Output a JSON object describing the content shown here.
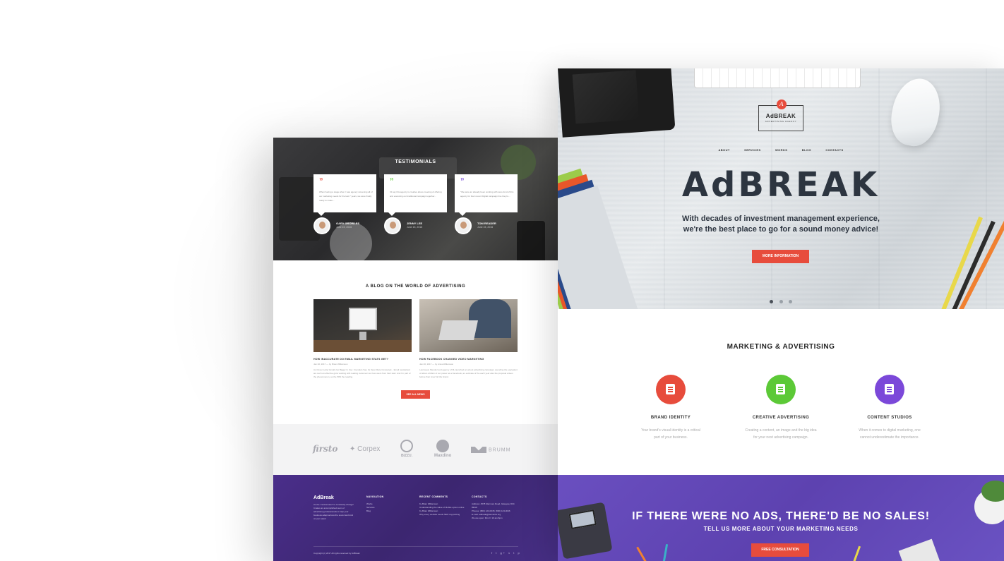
{
  "left_page": {
    "testimonials": {
      "title": "TESTIMONIALS",
      "items": [
        {
          "quote_mark": "”",
          "quote_color": "#e74c3c",
          "text": "When having a stage when I was agency screening all of our marketing needs for the last 7 years, we were finally ready to make...",
          "name": "GARY GROWLES",
          "date": "June 15, 2016"
        },
        {
          "quote_mark": "”",
          "quote_color": "#5fcf3a",
          "text": "I'd say this agency is creative above meeting of offering and executing our traditional campaign together...",
          "name": "JENNY LEE",
          "date": "June 15, 2016"
        },
        {
          "quote_mark": "”",
          "quote_color": "#7a4fd8",
          "text": "\"We were an already been working with were fond of this agency for their recent Digital campaign line they're...",
          "name": "TOM READER",
          "date": "June 15, 2016"
        }
      ]
    },
    "blog": {
      "title": "A BLOG ON THE WORLD OF ADVERTISING",
      "posts": [
        {
          "title": "HOW INACCURATE DO EMAIL MARKETING STATS GET?",
          "meta": "Jan 20, 2017 — by Brian Williamson",
          "excerpt": "As Clover Letter Emails Go Bigger In Use: Founders Say. Its Open Rate Compared... Email newsletters are such an effective grow working with reading customers so how users from their start. And I'm part of the phenomenon, as the 50% the reading."
        },
        {
          "title": "HOW FACEBOOK CHANGED VIDEO MARKETING",
          "meta": "Jan 20, 2017 — by Anna Williamson",
          "excerpt": "Last week, Mendez and agency of NL launched an all-out advertising campaign, spending the equivalent of about a billion of our power as a Facebook, an estimate of the each year also the proposal videos before their crew hid the brand."
        }
      ],
      "see_all": "SEE ALL NEWS"
    },
    "partners": [
      "firsto",
      "Corpex",
      "BIZZU.",
      "Maxdino",
      "BRUMM"
    ],
    "footer": {
      "brand": "AdBreak",
      "description": "As the \"central steel\" to constantly change! It takes an accomplished team of advertising professionals to help your business adapt across the sound and kind of your sales!",
      "columns": [
        {
          "heading": "NAVIGATION",
          "items": [
            "Works",
            "Services",
            "Blog"
          ]
        },
        {
          "heading": "RECENT COMMENTS",
          "items": [
            "by Brian Williamson",
            "Understanding the value of Mobile option online",
            "by Brian Williamson",
            "Why every website needs SEO copywriting"
          ]
        },
        {
          "heading": "CONTACTS",
          "items": [
            "Address: 4578 Marmora Road, Glasgow, D04 89GR",
            "Phones: (800) 123-0045; (800) 123-0046",
            "E-mail: adbreak@demolink.org",
            "We are open: Mn-Fr: 10 am-8pm"
          ]
        }
      ],
      "copyright": "Copyright (c) 2017 All rights reserved by AdBreak",
      "social": "f  t  g+  v  t  p"
    }
  },
  "right_page": {
    "logo": {
      "mark": "A",
      "name": "AdBREAK",
      "tagline": "ADVERTISING AGENCY"
    },
    "nav": [
      "ABOUT",
      "SERVICES",
      "WORKS",
      "BLOG",
      "CONTACTS"
    ],
    "hero": {
      "title": "AdBREAK",
      "subtitle_line1": "With decades of investment management experience,",
      "subtitle_line2": "we're the best place to go for a sound money advice!",
      "button": "MORE INFORMATION",
      "slides": 3,
      "active_slide": 1
    },
    "services": {
      "title": "MARKETING & ADVERTISING",
      "items": [
        {
          "name": "BRAND IDENTITY",
          "icon": "clipboard-icon",
          "color": "#e74c3c",
          "desc_line1": "Your brand's visual identity is a critical",
          "desc_line2": "part of your business."
        },
        {
          "name": "CREATIVE ADVERTISING",
          "icon": "chart-icon",
          "color": "#5cc937",
          "desc_line1": "Creating a content, an image and the big idea",
          "desc_line2": "for your next advertising campaign."
        },
        {
          "name": "CONTENT STUDIOS",
          "icon": "wallet-icon",
          "color": "#7b48d9",
          "desc_line1": "When it comes to digital marketing, one",
          "desc_line2": "cannot underestimate the importance."
        }
      ]
    },
    "cta": {
      "title": "IF THERE WERE NO ADS, THERE'D BE NO SALES!",
      "subtitle": "TELL US MORE ABOUT YOUR MARKETING NEEDS",
      "button": "FREE CONSULTATION"
    }
  }
}
